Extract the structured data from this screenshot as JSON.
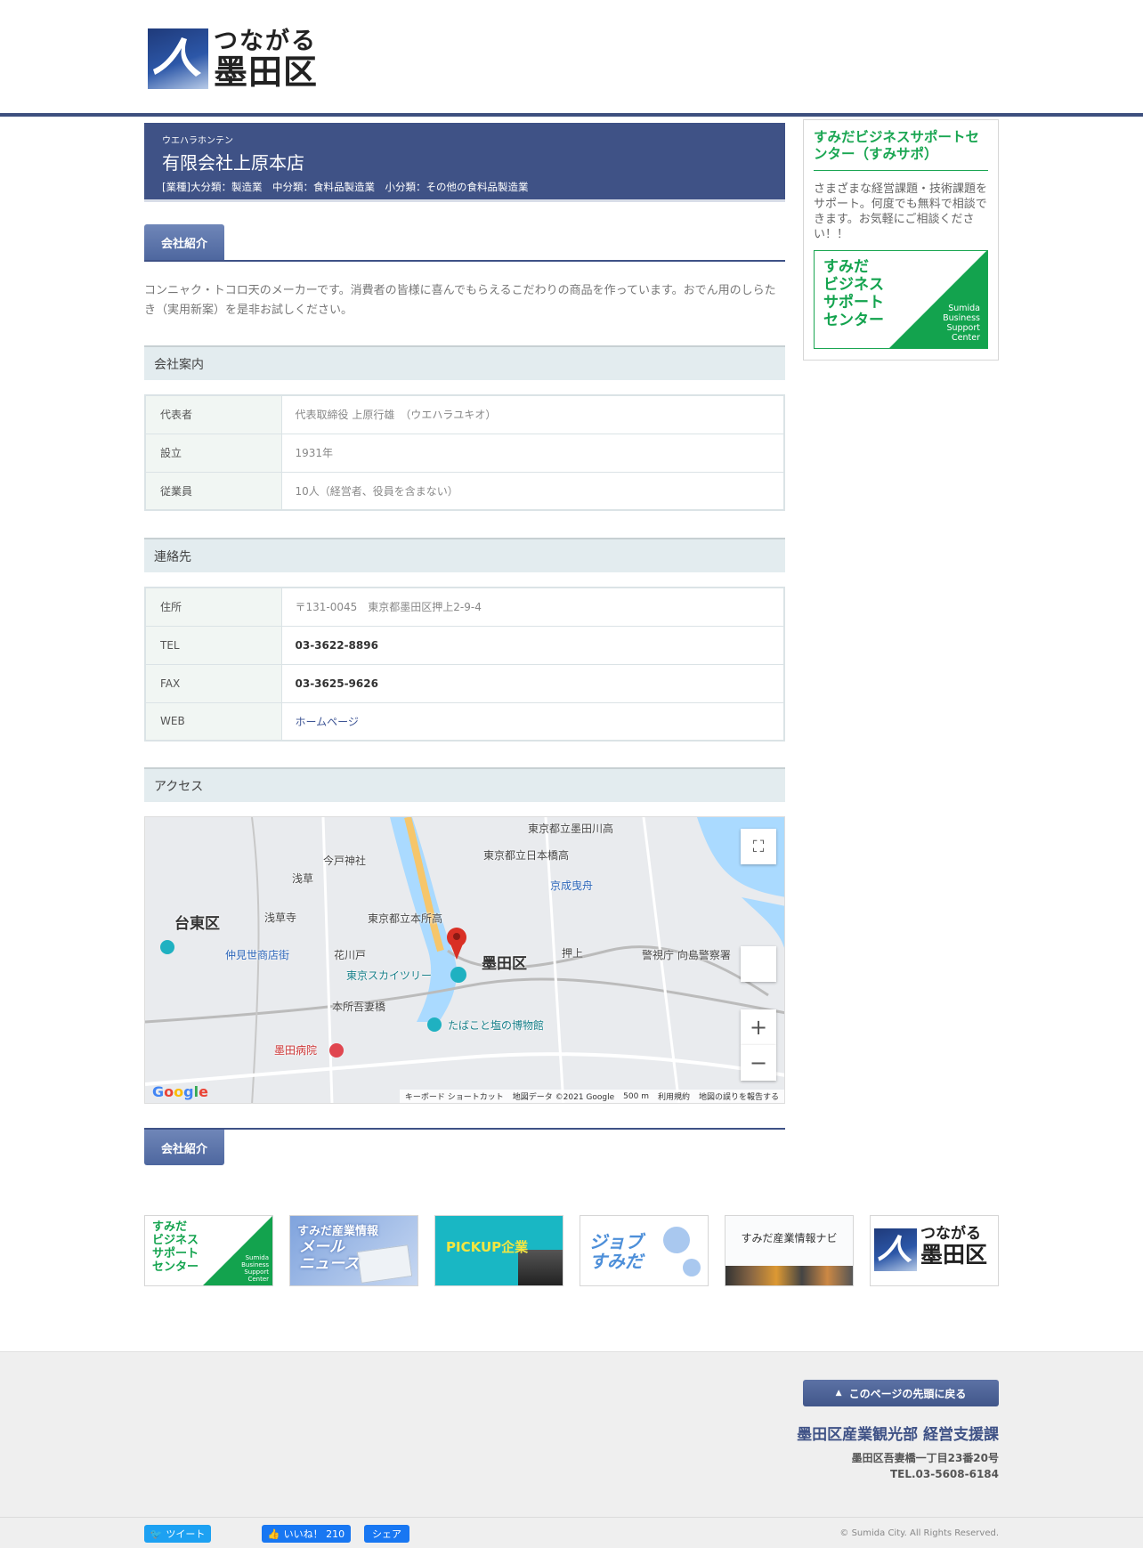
{
  "header": {
    "logo_line1": "つながる",
    "logo_line2": "墨田区"
  },
  "company": {
    "kana": "ウエハラホンテン",
    "name": "有限会社上原本店",
    "category": "[業種]大分類：製造業　中分類：食料品製造業　小分類：その他の食料品製造業"
  },
  "intro_tab": "会社紹介",
  "intro_text": "コンニャク・トコロ天のメーカーです。消費者の皆様に喜んでもらえるこだわりの商品を作っています。おでん用のしらたき（実用新案）を是非お試しください。",
  "company_info": {
    "heading": "会社案内",
    "rows": [
      {
        "key": "代表者",
        "value": "代表取締役 上原行雄　（ウエハラユキオ）"
      },
      {
        "key": "設立",
        "value": "1931年"
      },
      {
        "key": "従業員",
        "value": "10人（経営者、役員を含まない）"
      }
    ]
  },
  "contact": {
    "heading": "連絡先",
    "address_key": "住所",
    "address": "〒131-0045　東京都墨田区押上2-9-4",
    "tel_key": "TEL",
    "tel": "03-3622-8896",
    "fax_key": "FAX",
    "fax": "03-3625-9626",
    "web_key": "WEB",
    "web": "ホームページ"
  },
  "access": {
    "heading": "アクセス",
    "map_labels": {
      "taito": "台東区",
      "sumida": "墨田区",
      "asakusa": "浅草",
      "sensoji": "浅草寺",
      "nakamise": "仲見世商店街",
      "skytree": "東京スカイツリー",
      "hikifune": "京成曳舟",
      "oshiage": "押上",
      "honjo": "本所吾妻橋",
      "tobacco": "たばこと塩の博物館",
      "imado": "今戸神社",
      "hospital": "墨田病院",
      "school": "東京都立本所高",
      "school2": "東京都立日本橋高",
      "school3": "東京都立墨田川高",
      "police": "警視庁 向島警察署",
      "hanakawado": "花川戸"
    },
    "map_footer": {
      "shortcuts": "キーボード ショートカット",
      "data": "地図データ ©2021 Google",
      "scale": "500 m",
      "terms": "利用規約",
      "report": "地図の誤りを報告する"
    },
    "google": "Google"
  },
  "bottom_tab": "会社紹介",
  "sidebar": {
    "title": "すみだビジネスサポートセンター（すみサポ）",
    "text": "さまざまな経営課題・技術課題をサポート。何度でも無料で相談できます。お気軽にご相談ください！！",
    "banner_ja": "すみだ\nビジネス\nサポート\nセンター",
    "banner_en": "Sumida\nBusiness\nSupport\nCenter"
  },
  "banners": {
    "b1_ja": "すみだ\nビジネス\nサポート\nセンター",
    "b1_en": "Sumida\nBusiness\nSupport\nCenter",
    "b2_title": "すみだ産業情報",
    "b2_sub": "メール\nニュース",
    "b3_title": "PICKUP企業",
    "b4_title": "ジョブ\nすみだ",
    "b5_title": "すみだ産業情報ナビ",
    "b6_l1": "つながる",
    "b6_l2": "墨田区"
  },
  "footer": {
    "to_top": "このページの先頭に戻る",
    "dept": "墨田区産業観光部 経営支援課",
    "address": "墨田区吾妻橋一丁目23番20号",
    "tel": "TEL.03-5608-6184",
    "tweet": "ツイート",
    "like": "いいね！ 210",
    "share": "シェア",
    "copyright": "© Sumida City. All Rights Reserved."
  },
  "colors": {
    "brand": "#3f5286",
    "green": "#13a34e"
  }
}
